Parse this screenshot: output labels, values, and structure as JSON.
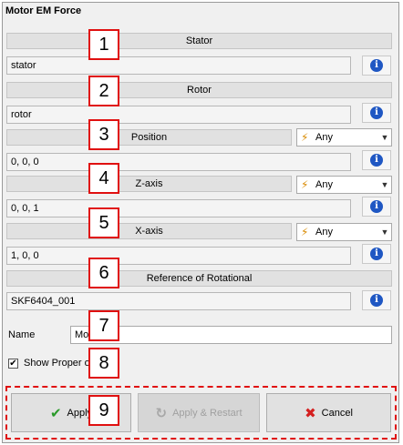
{
  "window": {
    "title": "Motor EM Force"
  },
  "stator": {
    "header": "Stator",
    "value": "stator"
  },
  "rotor": {
    "header": "Rotor",
    "value": "rotor"
  },
  "position": {
    "header": "Position",
    "value": "0, 0, 0",
    "mode": "Any"
  },
  "zaxis": {
    "header": "Z-axis",
    "value": "0, 0, 1",
    "mode": "Any"
  },
  "xaxis": {
    "header": "X-axis",
    "value": "1, 0, 0",
    "mode": "Any"
  },
  "reference": {
    "header": "Reference of Rotational",
    "value": "SKF6404_001"
  },
  "name": {
    "label": "Name",
    "value": "Mo         l"
  },
  "show_property": {
    "label": "Show Proper        og",
    "checked": true
  },
  "buttons": {
    "apply": "Apply",
    "apply_restart": "Apply & Restart",
    "cancel": "Cancel"
  },
  "badges": [
    "1",
    "2",
    "3",
    "4",
    "5",
    "6",
    "7",
    "8",
    "9"
  ],
  "icons": {
    "info": "info-icon",
    "select": "wand-icon",
    "check": "check-icon",
    "cancel": "x-icon"
  },
  "colors": {
    "badge_border": "#e01010",
    "info_blue": "#1f57c3"
  }
}
